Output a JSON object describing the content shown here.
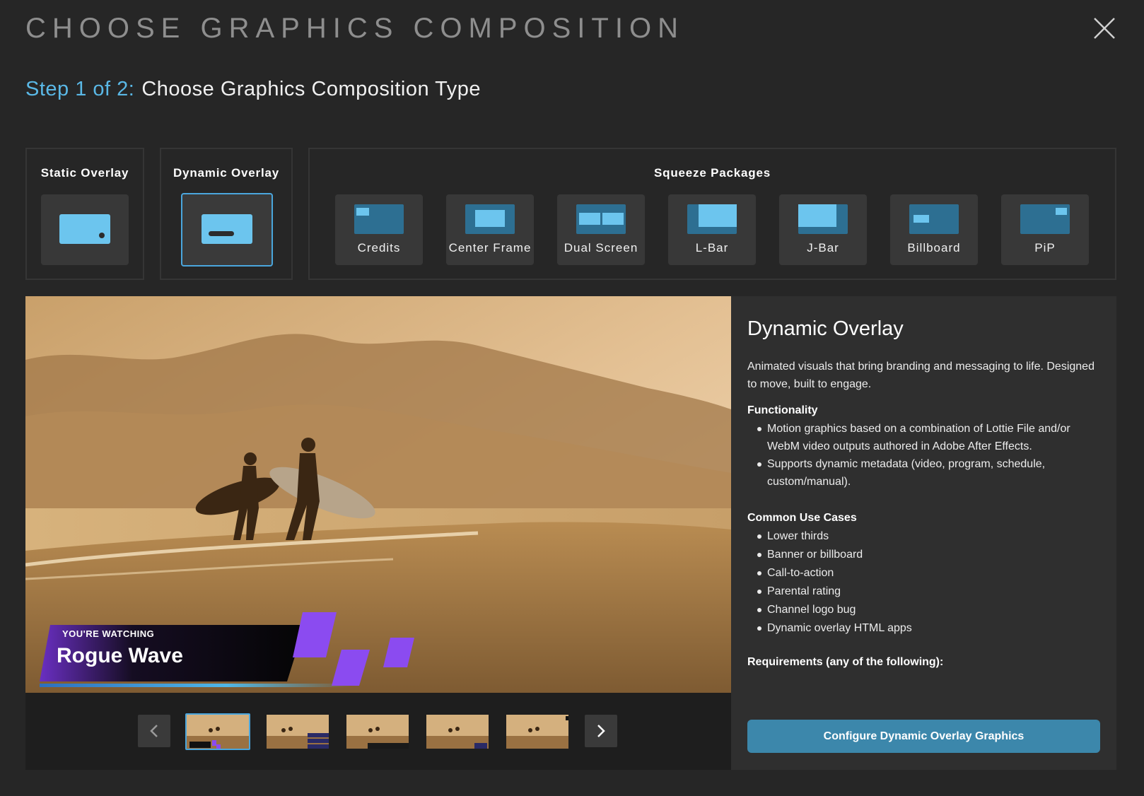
{
  "header": {
    "title": "CHOOSE GRAPHICS COMPOSITION",
    "step_label": "Step 1 of 2:",
    "step_text": "Choose Graphics Composition Type"
  },
  "groups": {
    "static": {
      "label": "Static Overlay"
    },
    "dynamic": {
      "label": "Dynamic Overlay",
      "selected": true
    },
    "squeeze": {
      "label": "Squeeze Packages",
      "items": [
        {
          "label": "Credits",
          "icon": "credits-layout-icon"
        },
        {
          "label": "Center Frame",
          "icon": "center-frame-layout-icon"
        },
        {
          "label": "Dual Screen",
          "icon": "dual-screen-layout-icon"
        },
        {
          "label": "L-Bar",
          "icon": "l-bar-layout-icon"
        },
        {
          "label": "J-Bar",
          "icon": "j-bar-layout-icon"
        },
        {
          "label": "Billboard",
          "icon": "billboard-layout-icon"
        },
        {
          "label": "PiP",
          "icon": "pip-layout-icon"
        }
      ]
    }
  },
  "preview": {
    "eyebrow": "YOU'RE WATCHING",
    "show_title": "Rogue Wave",
    "thumbnail_count": 5,
    "active_thumbnail": 1
  },
  "info": {
    "title": "Dynamic Overlay",
    "description": "Animated visuals that bring branding and messaging to life. Designed to move, built to engage.",
    "functionality_heading": "Functionality",
    "functionality": [
      "Motion graphics based on a combination of Lottie File and/or WebM video outputs authored in Adobe After Effects.",
      "Supports dynamic metadata (video, program, schedule, custom/manual)."
    ],
    "use_cases_heading": "Common Use Cases",
    "use_cases": [
      "Lower thirds",
      "Banner or billboard",
      "Call-to-action",
      "Parental rating",
      "Channel logo bug",
      "Dynamic overlay HTML apps"
    ],
    "requirements_heading": "Requirements (any of the following):",
    "cta_label": "Configure Dynamic Overlay Graphics"
  },
  "colors": {
    "accent": "#5ab8e6",
    "selected_border": "#4aa6dd",
    "cta": "#3c87ab",
    "lower_third_purple": "#8b4bf0"
  }
}
